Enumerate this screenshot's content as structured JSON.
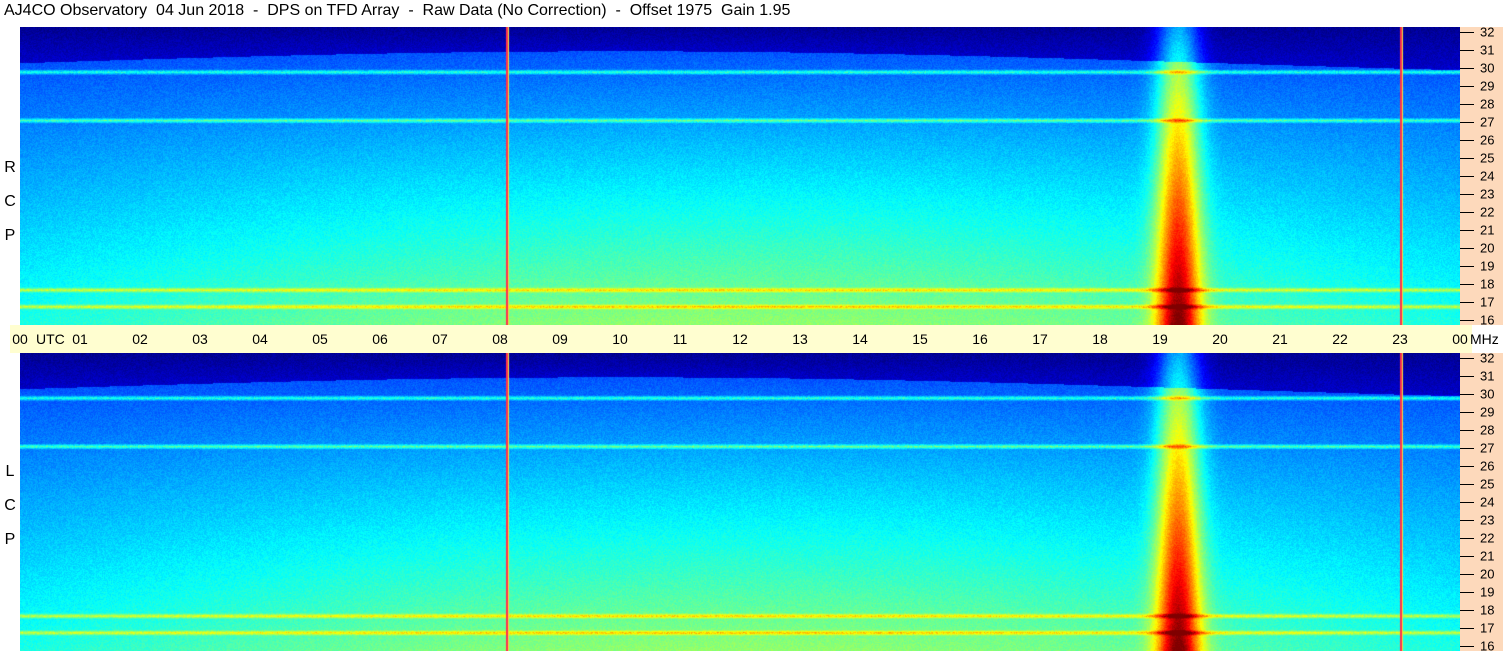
{
  "title": "AJ4CO Observatory  04 Jun 2018  -  DPS on TFD Array  -  Raw Data (No Correction)  -  Offset 1975  Gain 1.95",
  "panels": [
    {
      "id": "rcp",
      "label": [
        "R",
        "C",
        "P"
      ]
    },
    {
      "id": "lcp",
      "label": [
        "L",
        "C",
        "P"
      ]
    }
  ],
  "time_axis": {
    "hours": [
      "00",
      "01",
      "02",
      "03",
      "04",
      "05",
      "06",
      "07",
      "08",
      "09",
      "10",
      "11",
      "12",
      "13",
      "14",
      "15",
      "16",
      "17",
      "18",
      "19",
      "20",
      "21",
      "22",
      "23",
      "00"
    ],
    "unit": "UTC"
  },
  "freq_axis": {
    "unit": "MHz",
    "ticks": [
      "16",
      "17",
      "18",
      "19",
      "20",
      "21",
      "22",
      "23",
      "24",
      "25",
      "26",
      "27",
      "28",
      "29",
      "30",
      "31",
      "32"
    ]
  },
  "colors": {
    "background_noise": "#1f6fe0",
    "high_freq_dark": "#000020",
    "burst_core": "#f0c030",
    "axis_time_bg": "#fffed0",
    "axis_freq_bg": "#fdd9bb"
  },
  "chart_data": {
    "type": "heatmap",
    "title": "AJ4CO Observatory  04 Jun 2018  -  DPS on TFD Array  -  Raw Data (No Correction)  -  Offset 1975  Gain 1.95",
    "xlabel": "UTC",
    "ylabel": "MHz",
    "xlim": [
      0,
      24
    ],
    "ylim": [
      16,
      32
    ],
    "series": [
      {
        "name": "RCP"
      },
      {
        "name": "LCP"
      }
    ],
    "features": {
      "broadband_emission_utc": [
        18.8,
        20.0
      ],
      "emission_peak_utc": 19.3,
      "vertical_lines_utc": [
        8.1,
        23.0
      ],
      "strong_band_mhz": [
        17.0,
        17.9,
        27.0,
        29.6
      ]
    }
  }
}
